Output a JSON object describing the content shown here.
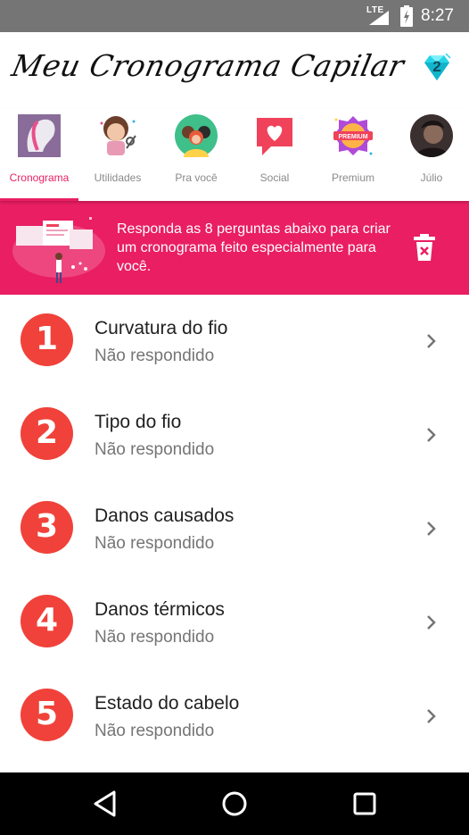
{
  "status_bar": {
    "network": "LTE",
    "time": "8:27"
  },
  "header": {
    "title": "Meu Cronograma Capilar",
    "gems_count": "2"
  },
  "tabs": [
    {
      "label": "Cronograma",
      "icon": "hair-profile-icon",
      "active": true
    },
    {
      "label": "Utilidades",
      "icon": "hairdresser-icon",
      "active": false
    },
    {
      "label": "Pra você",
      "icon": "people-group-icon",
      "active": false
    },
    {
      "label": "Social",
      "icon": "heart-chat-icon",
      "active": false
    },
    {
      "label": "Premium",
      "icon": "premium-badge-icon",
      "active": false
    },
    {
      "label": "Júlio",
      "icon": "user-avatar-icon",
      "active": false
    }
  ],
  "banner": {
    "text": "Responda as 8 perguntas abaixo para criar um cronograma feito especialmente para você."
  },
  "questions": [
    {
      "number": "1",
      "title": "Curvatura do fio",
      "status": "Não respondido"
    },
    {
      "number": "2",
      "title": "Tipo do fio",
      "status": "Não respondido"
    },
    {
      "number": "3",
      "title": "Danos causados",
      "status": "Não respondido"
    },
    {
      "number": "4",
      "title": "Danos térmicos",
      "status": "Não respondido"
    },
    {
      "number": "5",
      "title": "Estado do cabelo",
      "status": "Não respondido"
    }
  ],
  "colors": {
    "accent": "#e91e63",
    "badge": "#f0423a",
    "status_bar": "#757575"
  }
}
